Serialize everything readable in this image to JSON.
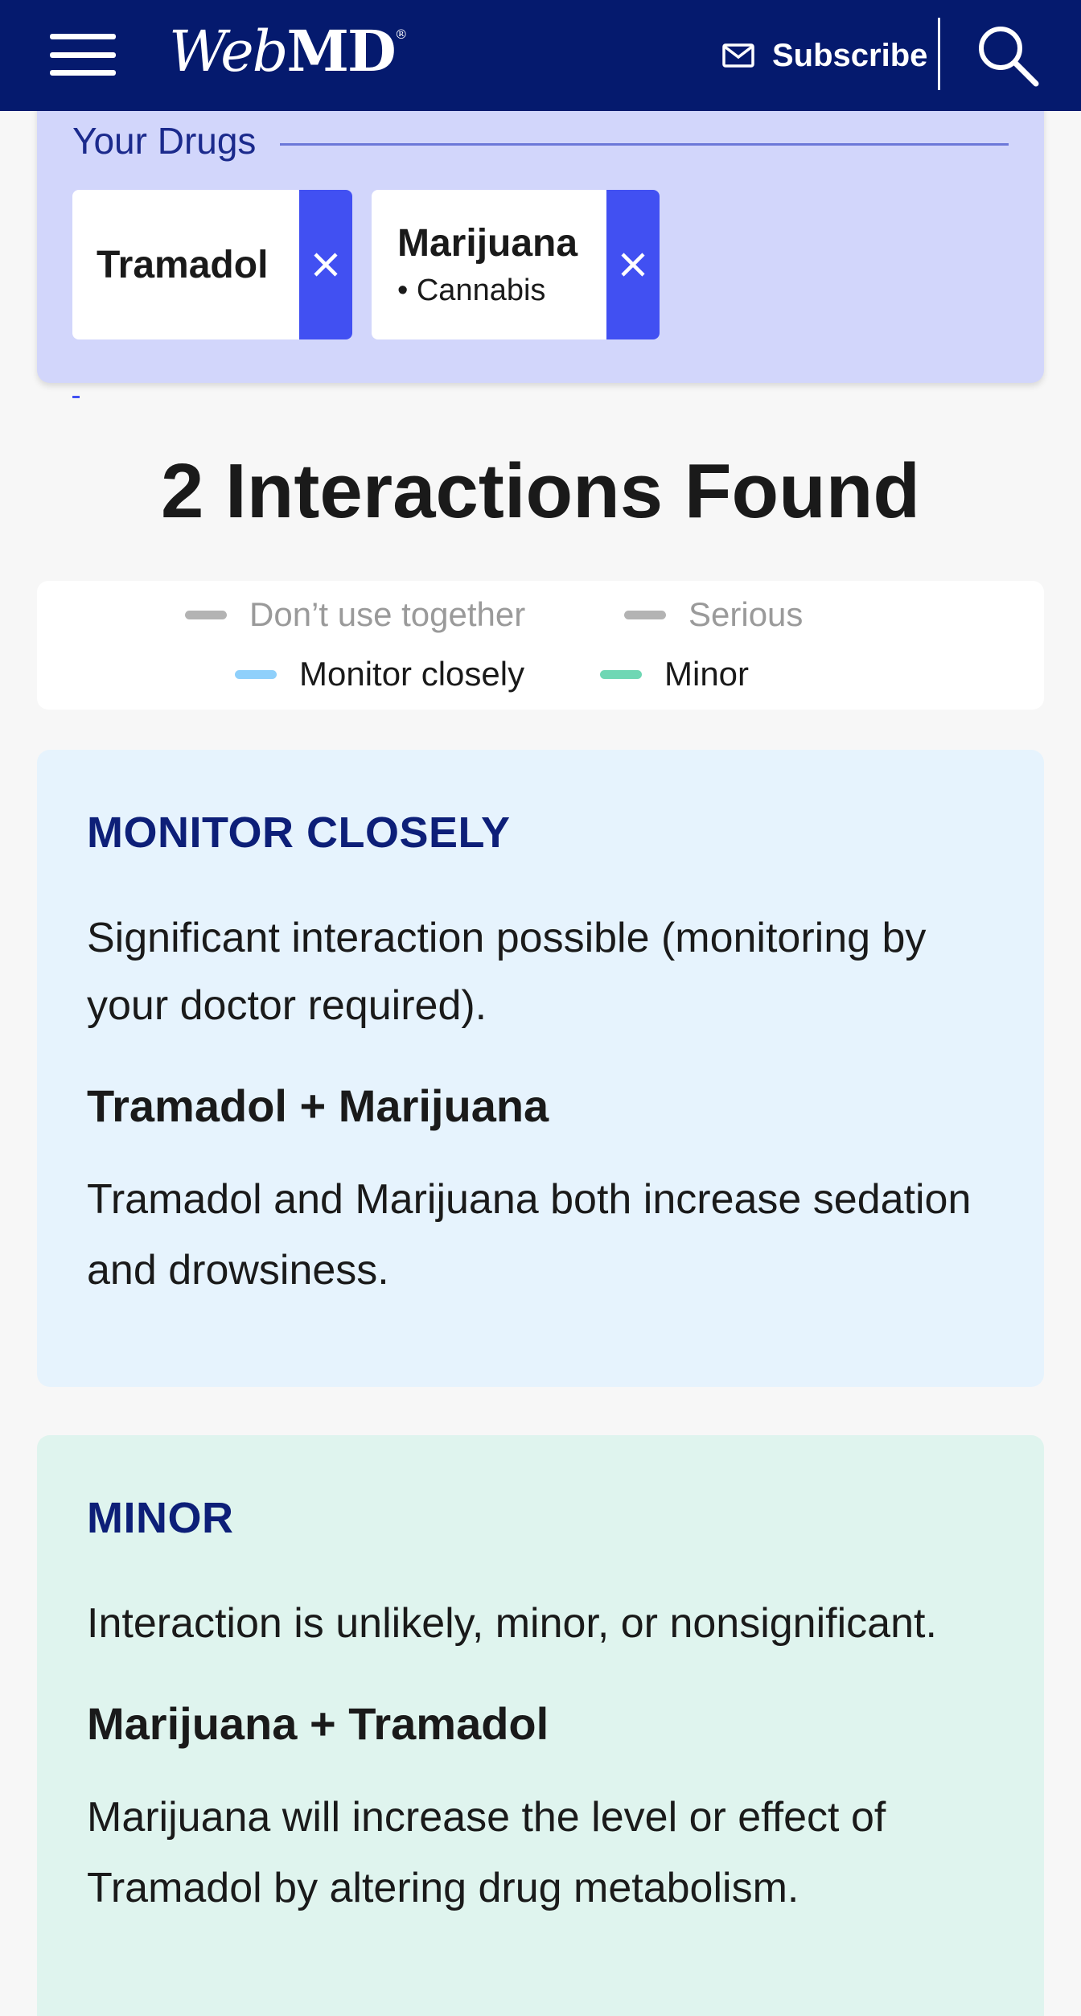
{
  "header": {
    "logo_web": "Web",
    "logo_md": "MD",
    "logo_reg": "®",
    "subscribe_label": "Subscribe",
    "icons": [
      "menu-icon",
      "mail-icon",
      "search-icon"
    ],
    "background": "#051a6e"
  },
  "drugs": {
    "title": "Your Drugs",
    "items": [
      {
        "name": "Tramadol",
        "sub": ""
      },
      {
        "name": "Marijuana",
        "sub": "• Cannabis"
      }
    ],
    "remove_color": "#4150f2",
    "panel_color": "#d2d6fb"
  },
  "results": {
    "headline": "2 Interactions Found"
  },
  "legend": [
    {
      "label": "Don’t use together",
      "color": "#b3b3b3",
      "disabled": true
    },
    {
      "label": "Serious",
      "color": "#b3b3b3",
      "disabled": true
    },
    {
      "label": "Monitor closely",
      "color": "#8fd0fb",
      "disabled": false
    },
    {
      "label": "Minor",
      "color": "#6fd7b4",
      "disabled": false
    }
  ],
  "interactions": [
    {
      "severity": "MONITOR CLOSELY",
      "description": "Significant interaction possible (monitoring by your doctor required).",
      "pair": "Tramadol + Marijuana",
      "detail": "Tramadol and Marijuana both increase sedation and drowsiness.",
      "color": "#e6f3fd"
    },
    {
      "severity": "MINOR",
      "description": "Interaction is unlikely, minor, or nonsignificant.",
      "pair": "Marijuana + Tramadol",
      "detail": "Marijuana will increase the level or effect of Tramadol by altering drug metabolism.",
      "color": "#dff4ee"
    }
  ]
}
